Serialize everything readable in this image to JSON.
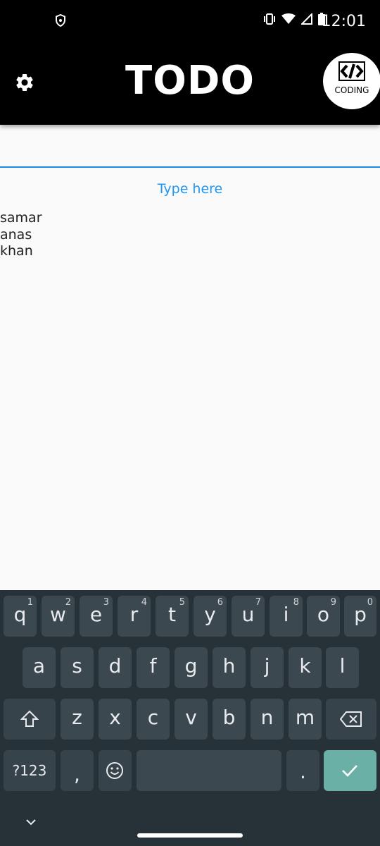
{
  "status_bar": {
    "time": "12:01",
    "icons": [
      "shield-icon",
      "vibrate-icon",
      "wifi-icon",
      "signal-icon",
      "battery-icon"
    ]
  },
  "app_bar": {
    "title": "TODO",
    "badge_text": "CODING"
  },
  "input": {
    "value": "",
    "placeholder": ""
  },
  "type_here_label": "Type here",
  "todos": [
    "samar",
    "anas",
    "khan"
  ],
  "keyboard": {
    "row1": [
      {
        "ch": "q",
        "hint": "1"
      },
      {
        "ch": "w",
        "hint": "2"
      },
      {
        "ch": "e",
        "hint": "3"
      },
      {
        "ch": "r",
        "hint": "4"
      },
      {
        "ch": "t",
        "hint": "5"
      },
      {
        "ch": "y",
        "hint": "6"
      },
      {
        "ch": "u",
        "hint": "7"
      },
      {
        "ch": "i",
        "hint": "8"
      },
      {
        "ch": "o",
        "hint": "9"
      },
      {
        "ch": "p",
        "hint": "0"
      }
    ],
    "row2": [
      "a",
      "s",
      "d",
      "f",
      "g",
      "h",
      "j",
      "k",
      "l"
    ],
    "row3": [
      "z",
      "x",
      "c",
      "v",
      "b",
      "n",
      "m"
    ],
    "symbols_label": "?123",
    "comma": ",",
    "period": "."
  },
  "colors": {
    "accent": "#2196f3",
    "appbar": "#000000",
    "keyboard_bg": "#263238",
    "key": "#3c4850",
    "enter": "#6ab0a6"
  }
}
